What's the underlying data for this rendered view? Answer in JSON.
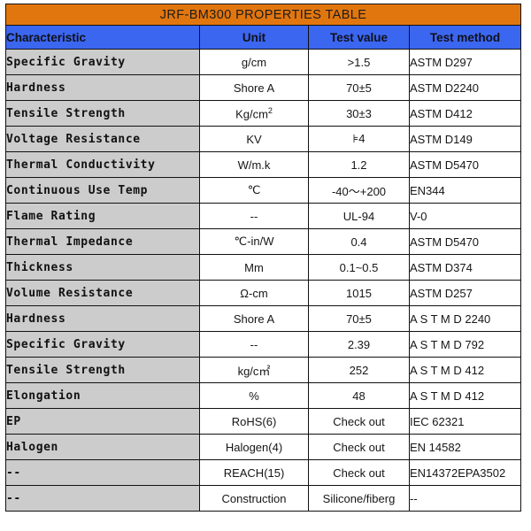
{
  "title": "JRF-BM300  PROPERTIES  TABLE",
  "accent_colors": {
    "title_band": "#e2760e",
    "header_band": "#3b66f0",
    "characteristic_cell": "#cccccc",
    "cell_background": "#ffffff",
    "border": "#111111"
  },
  "columns": [
    {
      "key": "characteristic",
      "label": "Characteristic"
    },
    {
      "key": "unit",
      "label": "Unit"
    },
    {
      "key": "test_value",
      "label": "Test value"
    },
    {
      "key": "test_method",
      "label": "Test method"
    }
  ],
  "rows": [
    {
      "characteristic": "Specific Gravity",
      "unit": "g/cm",
      "test_value": ">1.5",
      "test_method": "ASTM  D297"
    },
    {
      "characteristic": "Hardness",
      "unit": "Shore A",
      "test_value": "70±5",
      "test_method": "ASTM  D2240"
    },
    {
      "characteristic": "Tensile Strength",
      "unit": "Kg/cm2",
      "test_value": "30±3",
      "test_method": "ASTM  D412"
    },
    {
      "characteristic": "Voltage Resistance",
      "unit": "KV",
      "test_value": "⊧4",
      "test_method": "ASTM  D149"
    },
    {
      "characteristic": "Thermal Conductivity",
      "unit": "W/m.k",
      "test_value": "1.2",
      "test_method": "ASTM  D5470"
    },
    {
      "characteristic": "Continuous Use Temp",
      "unit": "℃",
      "test_value": "-40～+200",
      "test_method": "EN344"
    },
    {
      "characteristic": "Flame Rating",
      "unit": "--",
      "test_value": "UL-94",
      "test_method": "V-0"
    },
    {
      "characteristic": "Thermal Impedance",
      "unit": "℃-in/W",
      "test_value": "0.4",
      "test_method": "ASTM  D5470"
    },
    {
      "characteristic": "Thickness",
      "unit": "Mm",
      "test_value": "0.1~0.5",
      "test_method": "ASTM  D374"
    },
    {
      "characteristic": "Volume Resistance",
      "unit": "Ω-cm",
      "test_value": "1015",
      "test_method": "ASTM  D257"
    },
    {
      "characteristic": "Hardness",
      "unit": "Shore A",
      "test_value": "70±5",
      "test_method": "A S T M   D 2240"
    },
    {
      "characteristic": "Specific Gravity",
      "unit": "--",
      "test_value": "2.39",
      "test_method": "A S T M   D 792"
    },
    {
      "characteristic": "Tensile Strength",
      "unit": "kg/c㎡",
      "test_value": "252",
      "test_method": "A S T M   D 412"
    },
    {
      "characteristic": "Elongation",
      "unit": "%",
      "test_value": "48",
      "test_method": "A S T M   D 412"
    },
    {
      "characteristic": "EP",
      "unit": "RoHS(6)",
      "test_value": "Check out",
      "test_method": "IEC 62321"
    },
    {
      "characteristic": "Halogen",
      "unit": "Halogen(4)",
      "test_value": "Check out",
      "test_method": "EN 14582"
    },
    {
      "characteristic": "--",
      "unit": "REACH(15)",
      "test_value": "Check out",
      "test_method": "EN14372EPA3502"
    },
    {
      "characteristic": "--",
      "unit": "Construction",
      "test_value": "Silicone/fiberg",
      "test_method": "--"
    }
  ]
}
